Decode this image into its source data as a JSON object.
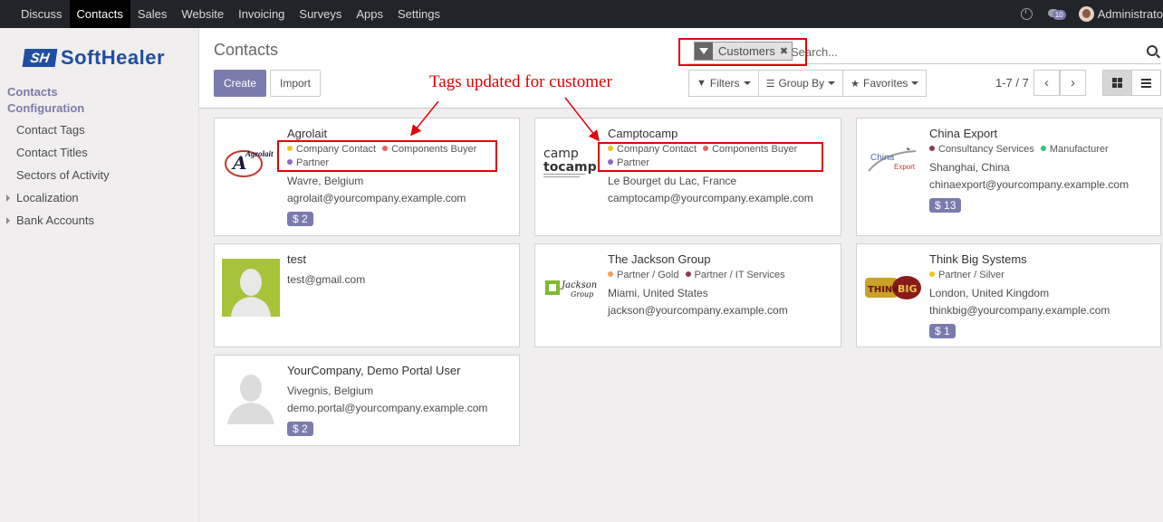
{
  "topbar": {
    "menu": [
      "Discuss",
      "Contacts",
      "Sales",
      "Website",
      "Invoicing",
      "Surveys",
      "Apps",
      "Settings"
    ],
    "active": "Contacts",
    "chat_count": "10",
    "user": "Administrato"
  },
  "logo": {
    "mark": "SH",
    "text": "SoftHealer"
  },
  "sidebar": {
    "header1": "Contacts",
    "header2": "Configuration",
    "items": [
      "Contact Tags",
      "Contact Titles",
      "Sectors of Activity",
      "Localization",
      "Bank Accounts"
    ]
  },
  "control_panel": {
    "title": "Contacts",
    "create_label": "Create",
    "import_label": "Import",
    "facet_label": "Customers",
    "search_placeholder": "Search...",
    "filters_label": "Filters",
    "groupby_label": "Group By",
    "favorites_label": "Favorites",
    "pager": "1-7 / 7"
  },
  "annotation": {
    "text": "Tags updated for customer",
    "color": "#e0040b"
  },
  "colors": {
    "accent": "#7c7bad",
    "tag_yellow": "#f0c419",
    "tag_red": "#f06060",
    "tag_purple": "#8e6bbf",
    "tag_maroon": "#8a3b52",
    "tag_green": "#30c381",
    "tag_orange": "#f0a05a"
  },
  "cards": [
    {
      "name": "Agrolait",
      "logo": "agrolait-logo",
      "logo_text": "Agrolait",
      "tags": [
        [
          "Company Contact",
          "tag_yellow"
        ],
        [
          "Components Buyer",
          "tag_red"
        ],
        [
          "Partner",
          "tag_purple"
        ]
      ],
      "address": "Wavre, Belgium",
      "email": "agrolait@yourcompany.example.com",
      "meetings": "2"
    },
    {
      "name": "Camptocamp",
      "logo": "camptocamp-logo",
      "logo_text": "camptocamp",
      "tags": [
        [
          "Company Contact",
          "tag_yellow"
        ],
        [
          "Components Buyer",
          "tag_red"
        ],
        [
          "Partner",
          "tag_purple"
        ]
      ],
      "address": "Le Bourget du Lac, France",
      "email": "camptocamp@yourcompany.example.com"
    },
    {
      "name": "China Export",
      "logo": "china-export-logo",
      "logo_text": "China Export",
      "tags": [
        [
          "Consultancy Services",
          "tag_maroon"
        ],
        [
          "Manufacturer",
          "tag_green"
        ]
      ],
      "address": "Shanghai, China",
      "email": "chinaexport@yourcompany.example.com",
      "meetings": "13"
    },
    {
      "name": "test",
      "logo": "avatar-placeholder-green",
      "tags": [],
      "email": "test@gmail.com"
    },
    {
      "name": "The Jackson Group",
      "logo": "jackson-group-logo",
      "logo_text": "Jackson Group",
      "tags": [
        [
          "Partner / Gold",
          "tag_orange"
        ],
        [
          "Partner / IT Services",
          "tag_maroon"
        ]
      ],
      "address": "Miami, United States",
      "email": "jackson@yourcompany.example.com"
    },
    {
      "name": "Think Big Systems",
      "logo": "think-big-logo",
      "logo_text": "THINK BIG",
      "tags": [
        [
          "Partner / Silver",
          "tag_yellow"
        ]
      ],
      "address": "London, United Kingdom",
      "email": "thinkbig@yourcompany.example.com",
      "meetings": "1"
    },
    {
      "name": "YourCompany, Demo Portal User",
      "logo": "avatar-placeholder-white",
      "tags": [],
      "address": "Vivegnis, Belgium",
      "email": "demo.portal@yourcompany.example.com",
      "meetings": "2"
    }
  ]
}
